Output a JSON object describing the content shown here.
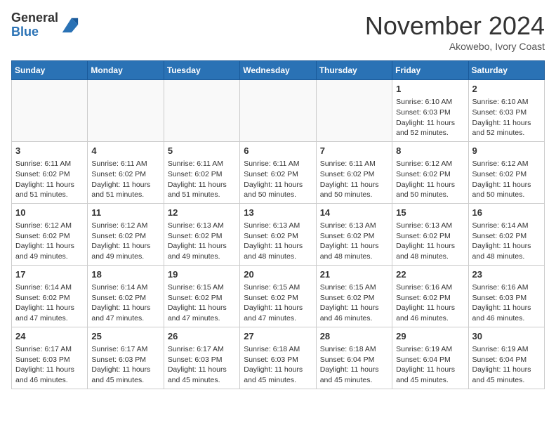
{
  "header": {
    "logo_line1": "General",
    "logo_line2": "Blue",
    "month_title": "November 2024",
    "location": "Akowebo, Ivory Coast"
  },
  "weekdays": [
    "Sunday",
    "Monday",
    "Tuesday",
    "Wednesday",
    "Thursday",
    "Friday",
    "Saturday"
  ],
  "weeks": [
    [
      {
        "day": "",
        "info": ""
      },
      {
        "day": "",
        "info": ""
      },
      {
        "day": "",
        "info": ""
      },
      {
        "day": "",
        "info": ""
      },
      {
        "day": "",
        "info": ""
      },
      {
        "day": "1",
        "info": "Sunrise: 6:10 AM\nSunset: 6:03 PM\nDaylight: 11 hours\nand 52 minutes."
      },
      {
        "day": "2",
        "info": "Sunrise: 6:10 AM\nSunset: 6:03 PM\nDaylight: 11 hours\nand 52 minutes."
      }
    ],
    [
      {
        "day": "3",
        "info": "Sunrise: 6:11 AM\nSunset: 6:02 PM\nDaylight: 11 hours\nand 51 minutes."
      },
      {
        "day": "4",
        "info": "Sunrise: 6:11 AM\nSunset: 6:02 PM\nDaylight: 11 hours\nand 51 minutes."
      },
      {
        "day": "5",
        "info": "Sunrise: 6:11 AM\nSunset: 6:02 PM\nDaylight: 11 hours\nand 51 minutes."
      },
      {
        "day": "6",
        "info": "Sunrise: 6:11 AM\nSunset: 6:02 PM\nDaylight: 11 hours\nand 50 minutes."
      },
      {
        "day": "7",
        "info": "Sunrise: 6:11 AM\nSunset: 6:02 PM\nDaylight: 11 hours\nand 50 minutes."
      },
      {
        "day": "8",
        "info": "Sunrise: 6:12 AM\nSunset: 6:02 PM\nDaylight: 11 hours\nand 50 minutes."
      },
      {
        "day": "9",
        "info": "Sunrise: 6:12 AM\nSunset: 6:02 PM\nDaylight: 11 hours\nand 50 minutes."
      }
    ],
    [
      {
        "day": "10",
        "info": "Sunrise: 6:12 AM\nSunset: 6:02 PM\nDaylight: 11 hours\nand 49 minutes."
      },
      {
        "day": "11",
        "info": "Sunrise: 6:12 AM\nSunset: 6:02 PM\nDaylight: 11 hours\nand 49 minutes."
      },
      {
        "day": "12",
        "info": "Sunrise: 6:13 AM\nSunset: 6:02 PM\nDaylight: 11 hours\nand 49 minutes."
      },
      {
        "day": "13",
        "info": "Sunrise: 6:13 AM\nSunset: 6:02 PM\nDaylight: 11 hours\nand 48 minutes."
      },
      {
        "day": "14",
        "info": "Sunrise: 6:13 AM\nSunset: 6:02 PM\nDaylight: 11 hours\nand 48 minutes."
      },
      {
        "day": "15",
        "info": "Sunrise: 6:13 AM\nSunset: 6:02 PM\nDaylight: 11 hours\nand 48 minutes."
      },
      {
        "day": "16",
        "info": "Sunrise: 6:14 AM\nSunset: 6:02 PM\nDaylight: 11 hours\nand 48 minutes."
      }
    ],
    [
      {
        "day": "17",
        "info": "Sunrise: 6:14 AM\nSunset: 6:02 PM\nDaylight: 11 hours\nand 47 minutes."
      },
      {
        "day": "18",
        "info": "Sunrise: 6:14 AM\nSunset: 6:02 PM\nDaylight: 11 hours\nand 47 minutes."
      },
      {
        "day": "19",
        "info": "Sunrise: 6:15 AM\nSunset: 6:02 PM\nDaylight: 11 hours\nand 47 minutes."
      },
      {
        "day": "20",
        "info": "Sunrise: 6:15 AM\nSunset: 6:02 PM\nDaylight: 11 hours\nand 47 minutes."
      },
      {
        "day": "21",
        "info": "Sunrise: 6:15 AM\nSunset: 6:02 PM\nDaylight: 11 hours\nand 46 minutes."
      },
      {
        "day": "22",
        "info": "Sunrise: 6:16 AM\nSunset: 6:02 PM\nDaylight: 11 hours\nand 46 minutes."
      },
      {
        "day": "23",
        "info": "Sunrise: 6:16 AM\nSunset: 6:03 PM\nDaylight: 11 hours\nand 46 minutes."
      }
    ],
    [
      {
        "day": "24",
        "info": "Sunrise: 6:17 AM\nSunset: 6:03 PM\nDaylight: 11 hours\nand 46 minutes."
      },
      {
        "day": "25",
        "info": "Sunrise: 6:17 AM\nSunset: 6:03 PM\nDaylight: 11 hours\nand 45 minutes."
      },
      {
        "day": "26",
        "info": "Sunrise: 6:17 AM\nSunset: 6:03 PM\nDaylight: 11 hours\nand 45 minutes."
      },
      {
        "day": "27",
        "info": "Sunrise: 6:18 AM\nSunset: 6:03 PM\nDaylight: 11 hours\nand 45 minutes."
      },
      {
        "day": "28",
        "info": "Sunrise: 6:18 AM\nSunset: 6:04 PM\nDaylight: 11 hours\nand 45 minutes."
      },
      {
        "day": "29",
        "info": "Sunrise: 6:19 AM\nSunset: 6:04 PM\nDaylight: 11 hours\nand 45 minutes."
      },
      {
        "day": "30",
        "info": "Sunrise: 6:19 AM\nSunset: 6:04 PM\nDaylight: 11 hours\nand 45 minutes."
      }
    ]
  ]
}
